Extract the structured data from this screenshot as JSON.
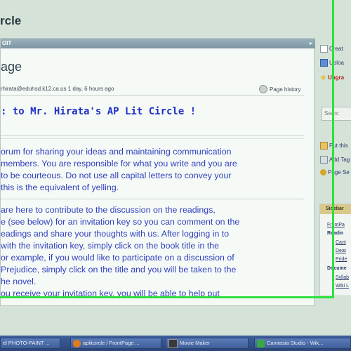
{
  "header": {
    "site_title": "rcle"
  },
  "main": {
    "edit_tab": "OIT",
    "edit_arrow": "▸",
    "page_heading": "age",
    "meta": "rhirata@eduhsd.k12.ca.us 1 day, 6 hours ago",
    "page_history": "Page history",
    "welcome": ": to Mr. Hirata's AP Lit Circle !",
    "paragraph1": [
      "orum for sharing your ideas and maintaining communication",
      " members. You are responsible for what you write and you are",
      " to be courteous. Do not use all capital letters to convey your",
      "this is the equivalent of yelling."
    ],
    "paragraph2": [
      "are here to contribute to the discussion on the readings,",
      "e (see below) for an invitation key so you can comment on the",
      "eadings and share your thoughts with us. After logging in to",
      "with the invitation key, simply click on the book title in the",
      "or example, if you would like to participate on a discussion of",
      "Prejudice, simply click on the title and you will be taken to the",
      "he novel.",
      "ou receive your invitation key, you will be able to help put"
    ]
  },
  "right_panel": {
    "top_items": [
      "Creat",
      "Uploa",
      "Upgra"
    ],
    "search_placeholder": "Searc",
    "mid_items": [
      "Put this",
      "Add Tag",
      "Page Se"
    ],
    "sidebar_title": "Sidebar",
    "sidebar_items": [
      "FrontPa",
      "Readin",
      "Cant",
      "Deat",
      "Pride",
      "Docume",
      "Syllab",
      "Wiki L"
    ]
  },
  "taskbar": {
    "items": [
      "el PHOTO-PAINT ...",
      "aplitcircle / FrontPage ...",
      "Movie Maker",
      "Camtasia Studio - Wik..."
    ]
  },
  "colors": {
    "recording_border": "#2ee03c",
    "welcome_text": "#1f2fc7",
    "body_text": "#2f3fc0",
    "taskbar": "#2b4678"
  }
}
